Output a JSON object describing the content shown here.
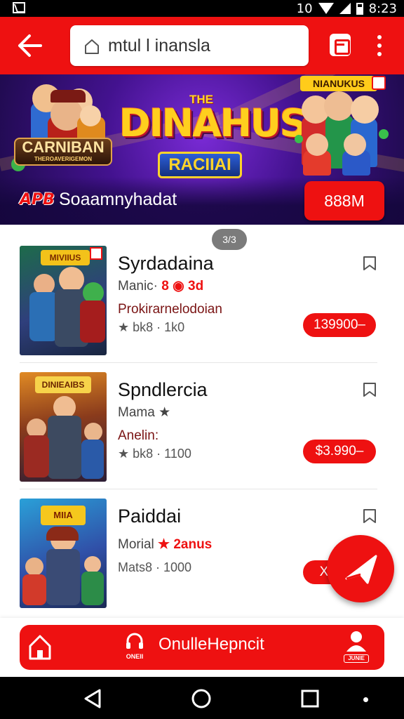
{
  "status_bar": {
    "time": "8:23",
    "network_label": "10"
  },
  "header": {
    "search_value": "mtul l inansla",
    "back_label": "back",
    "menu_label": "more options"
  },
  "banner": {
    "small_word": "THE",
    "title": "DINAHUSS",
    "subtitle": "RACIIAI",
    "left_logo": "CARNIBAN",
    "left_logo_sub": "THEROAVERIGEMON",
    "right_logo": "NIANUKUS",
    "app_tag": "APB",
    "text": "Soaamnyhadat",
    "cta_label": "888M"
  },
  "pager": "3/3",
  "items": [
    {
      "title": "Syrdadaina",
      "meta_prefix": "Manic· ",
      "meta_highlight": "8 ◉ 3d",
      "tagline": "Prokirarnelodoian",
      "stats": "★ bk8 · 1k0",
      "price": "139900–",
      "thumb_label": "MIVIIUS"
    },
    {
      "title": "Spndlercia",
      "meta_prefix": "Mama ★",
      "meta_highlight": "",
      "tagline": "Anelin:",
      "stats": "★ bk8 · 1100",
      "price": "$3.990–",
      "thumb_label": "DINIEAIBS"
    },
    {
      "title": "Paiddai",
      "meta_prefix": "Morial ",
      "meta_highlight": "★ 2anus",
      "tagline": "",
      "stats": "Mats8 · 1000",
      "price": "X",
      "thumb_label": "MIIA"
    }
  ],
  "bottom_nav": {
    "center_caption": "ONEII",
    "center_label": "OnulleHepncit",
    "profile_caption": "JUNIE"
  },
  "colors": {
    "primary": "#ee1111",
    "banner_bg": "#43128f",
    "title_yellow": "#ffcf1e"
  },
  "icons": [
    "back-arrow-icon",
    "home-icon",
    "document-icon",
    "more-vert-icon",
    "bookmark-icon",
    "send-icon",
    "headset-icon",
    "profile-icon",
    "nav-back-icon",
    "nav-home-icon",
    "nav-recents-icon"
  ]
}
